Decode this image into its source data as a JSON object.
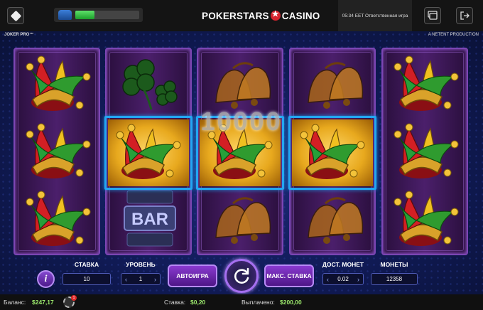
{
  "header": {
    "brand_left": "POKERSTARS",
    "brand_right": "CASINO",
    "session_text": "05:34 EET Ответственная игра",
    "cashier_progress": 0.3
  },
  "game": {
    "title": "JOKER PRO™",
    "provider": "A NETENT PRODUCTION",
    "win_amount": "10000",
    "reels": [
      [
        "jester-icon",
        "jester-icon",
        "jester-icon"
      ],
      [
        "clover-icon",
        "jester-icon",
        "bar-icon"
      ],
      [
        "bell-icon",
        "jester-icon",
        "bell-icon"
      ],
      [
        "bell-icon",
        "jester-icon",
        "bell-icon"
      ],
      [
        "jester-icon",
        "jester-icon",
        "jester-icon"
      ]
    ],
    "winning_row": 1,
    "bar_symbol_text": "BAR"
  },
  "controls": {
    "info_label": "i",
    "bet_label": "СТАВКА",
    "bet_value": "10",
    "level_label": "УРОВЕНЬ",
    "level_value": "1",
    "autoplay_label": "АВТОИГРА",
    "maxbet_label": "МАКС. СТАВКА",
    "coin_value_label": "ДОСТ. МОНЕТ",
    "coin_value": "0.02",
    "coins_label": "МОНЕТЫ",
    "coins_value": "12358"
  },
  "footer": {
    "balance_label": "Баланс:",
    "balance_value": "$247,17",
    "notifications_count": "1",
    "stake_label": "Ставка:",
    "stake_value": "$0,20",
    "paid_label": "Выплачено:",
    "paid_value": "$200,00"
  },
  "colors": {
    "win_frame": "#23a6f2",
    "reel_border": "#7c46b4",
    "value_green": "#9be86c",
    "brand_red": "#d6232d"
  }
}
